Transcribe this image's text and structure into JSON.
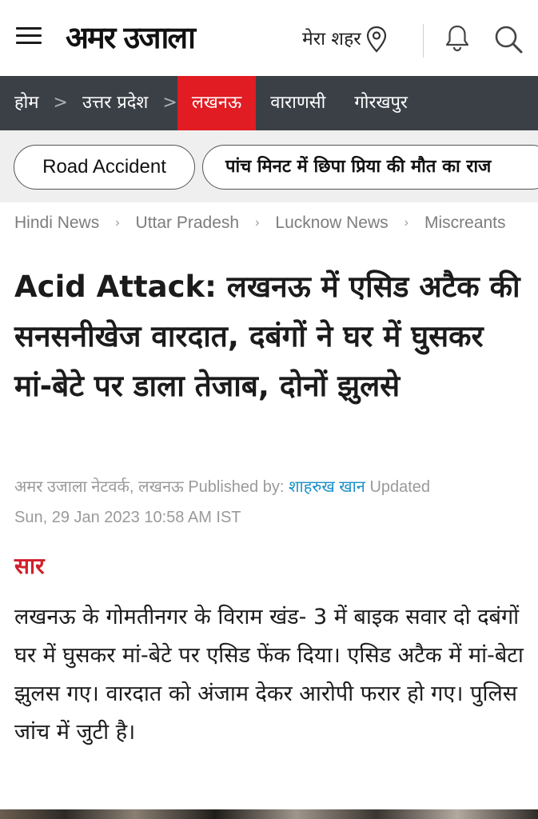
{
  "header": {
    "logo_text": "अमर उजाला",
    "city_label": "मेरा शहर"
  },
  "nav": {
    "items": [
      {
        "label": "होम"
      },
      {
        "label": "उत्तर प्रदेश"
      },
      {
        "label": "लखनऊ",
        "active": true
      },
      {
        "label": "वाराणसी"
      },
      {
        "label": "गोरखपुर"
      }
    ],
    "separator": ">",
    "active_color": "#e11c22",
    "bar_color": "#3b4046"
  },
  "chips": [
    {
      "label": "Road Accident"
    },
    {
      "label": "पांच मिनट में छिपा प्रिया की मौत का राज"
    }
  ],
  "breadcrumb": [
    {
      "label": "Hindi News"
    },
    {
      "label": "Uttar Pradesh"
    },
    {
      "label": "Lucknow News"
    },
    {
      "label": "Miscreants"
    }
  ],
  "article": {
    "headline": "Acid Attack: लखनऊ में एसिड अटैक की सनसनीखेज वारदात, दबंगों ने घर में घुसकर मां-बेटे पर डाला तेजाब, दोनों झुलसे",
    "byline": {
      "source": "अमर उजाला नेटवर्क, लखनऊ",
      "published_by_label": "Published by:",
      "author": "शाहरुख खान",
      "updated_label": "Updated",
      "updated": "Sun, 29 Jan 2023 10:58 AM IST"
    },
    "summary_label": "सार",
    "summary": "लखनऊ के गोमतीनगर के विराम खंड- 3 में बाइक सवार दो दबंगों घर में घुसकर मां-बेटे पर एसिड फेंक दिया। एसिड अटैक में मां-बेटा झुलस गए। वारदात को अंजाम देकर आरोपी फरार हो गए। पुलिस जांच में जुटी है।"
  },
  "colors": {
    "author_link": "#1a8fc9",
    "summary_label": "#d11e2a"
  },
  "icons": [
    "hamburger-menu-icon",
    "location-pin-icon",
    "bell-icon",
    "search-icon",
    "chevron-right-icon"
  ]
}
